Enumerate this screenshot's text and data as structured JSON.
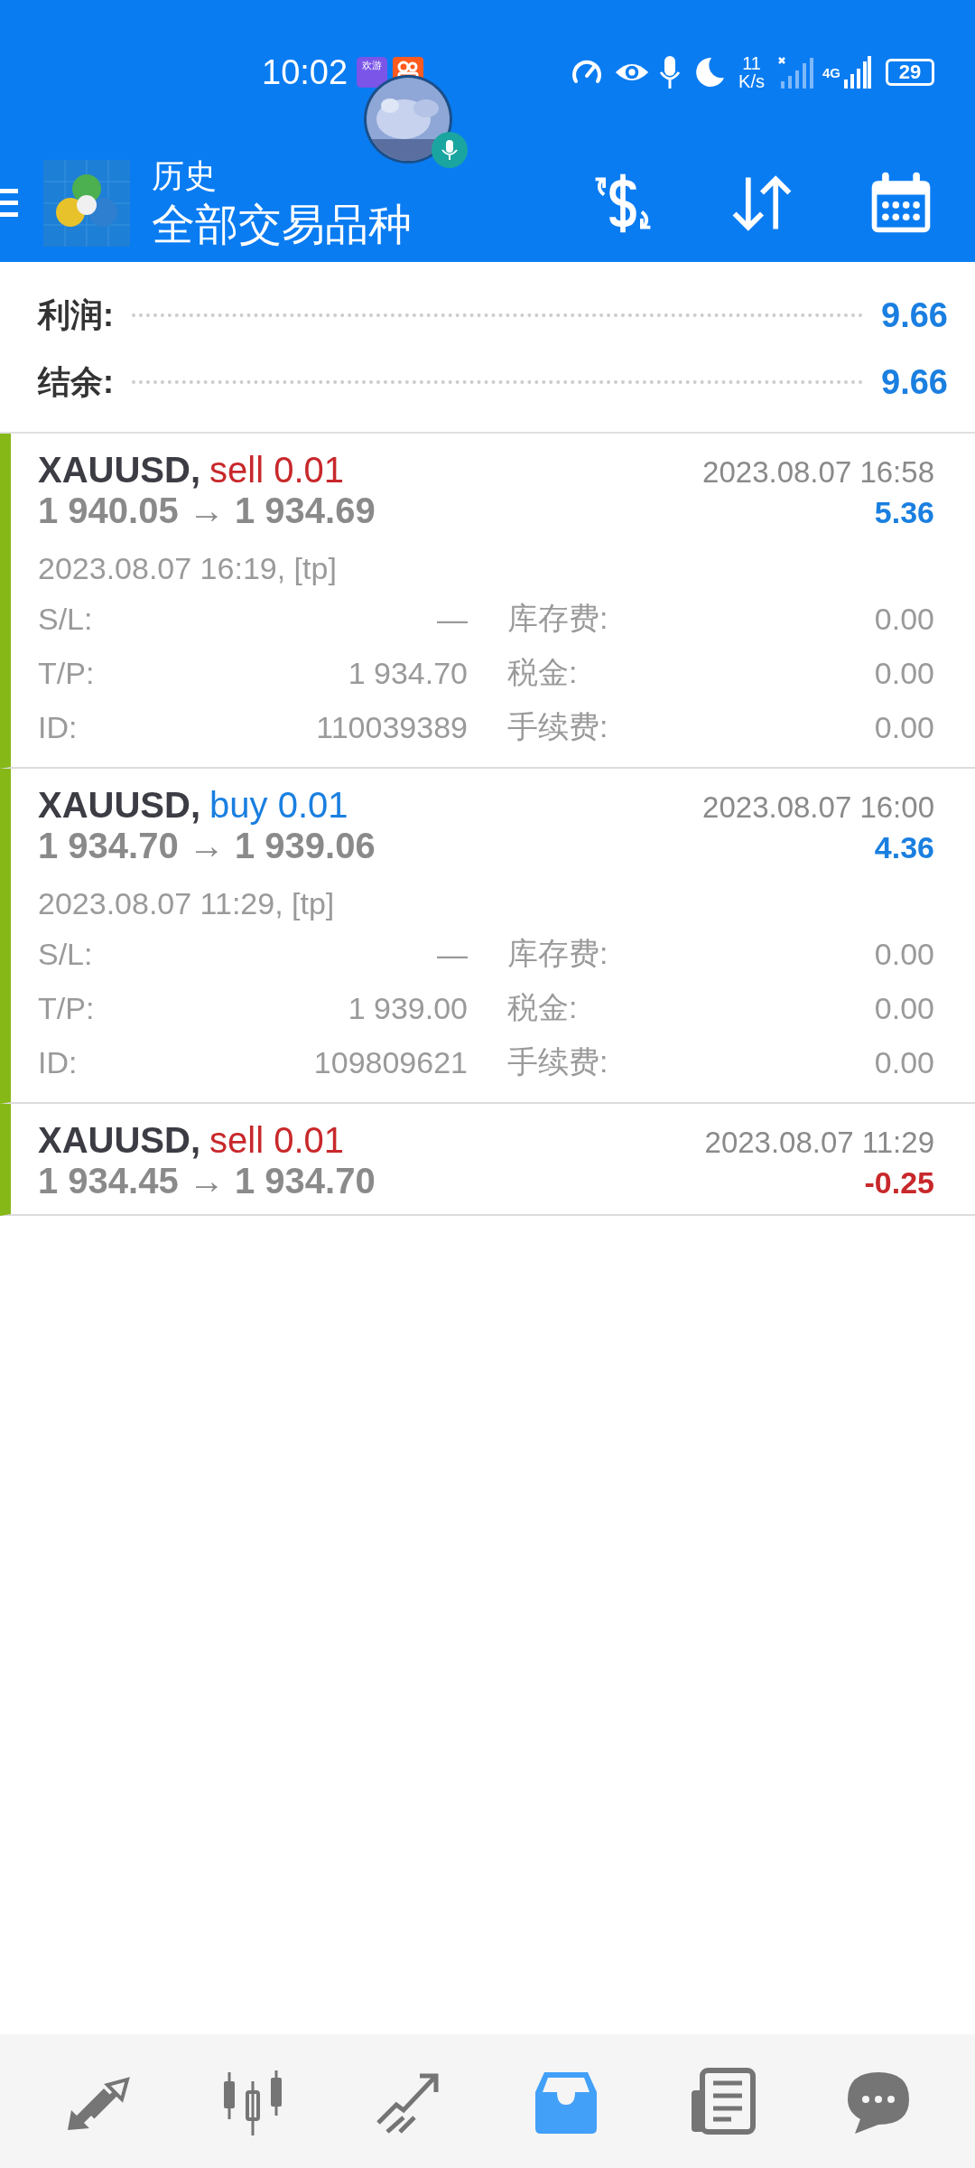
{
  "status_bar": {
    "time": "10:02",
    "app_icons": [
      {
        "kind": "game",
        "label": "欢游"
      },
      {
        "kind": "video"
      }
    ],
    "speed_value": "11",
    "speed_unit": "K/s",
    "network": "4G",
    "battery": "29"
  },
  "header": {
    "title": "历史",
    "subtitle": "全部交易品种"
  },
  "summary": [
    {
      "label": "利润:",
      "value": "9.66"
    },
    {
      "label": "结余:",
      "value": "9.66"
    }
  ],
  "trades": [
    {
      "symbol": "XAUUSD,",
      "direction": "sell",
      "volume": "0.01",
      "close_time": "2023.08.07 16:58",
      "prices": "1 940.05 → 1 934.69",
      "profit": "5.36",
      "loss": false,
      "expanded": true,
      "open_info": "2023.08.07 16:19, [tp]",
      "details": [
        {
          "label": "S/L:",
          "value": "—",
          "label2": "库存费:",
          "value2": "0.00"
        },
        {
          "label": "T/P:",
          "value": "1 934.70",
          "label2": "税金:",
          "value2": "0.00"
        },
        {
          "label": "ID:",
          "value": "110039389",
          "label2": "手续费:",
          "value2": "0.00"
        }
      ]
    },
    {
      "symbol": "XAUUSD,",
      "direction": "buy",
      "volume": "0.01",
      "close_time": "2023.08.07 16:00",
      "prices": "1 934.70 → 1 939.06",
      "profit": "4.36",
      "loss": false,
      "expanded": true,
      "open_info": "2023.08.07 11:29, [tp]",
      "details": [
        {
          "label": "S/L:",
          "value": "—",
          "label2": "库存费:",
          "value2": "0.00"
        },
        {
          "label": "T/P:",
          "value": "1 939.00",
          "label2": "税金:",
          "value2": "0.00"
        },
        {
          "label": "ID:",
          "value": "109809621",
          "label2": "手续费:",
          "value2": "0.00"
        }
      ]
    },
    {
      "symbol": "XAUUSD,",
      "direction": "sell",
      "volume": "0.01",
      "close_time": "2023.08.07 11:29",
      "prices": "1 934.45 → 1 934.70",
      "profit": "-0.25",
      "loss": true,
      "expanded": false
    }
  ],
  "bottom_nav": [
    {
      "kind": "trade",
      "selected": false
    },
    {
      "kind": "quotes",
      "selected": false
    },
    {
      "kind": "chart",
      "selected": false
    },
    {
      "kind": "history",
      "selected": true
    },
    {
      "kind": "news",
      "selected": false
    },
    {
      "kind": "chat",
      "selected": false
    }
  ]
}
